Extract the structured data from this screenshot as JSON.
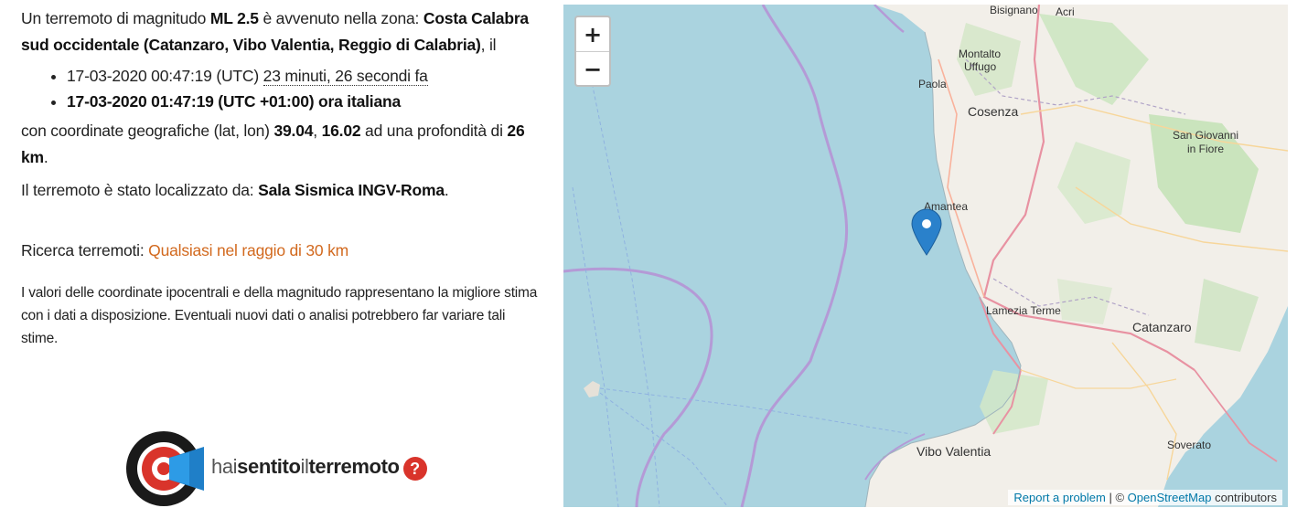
{
  "text": {
    "p1_a": "Un terremoto di magnitudo ",
    "p1_mag": "ML 2.5",
    "p1_b": " è avvenuto nella zona: ",
    "p1_zone": "Costa Calabra sud occidentale (Catanzaro, Vibo Valentia, Reggio di Calabria)",
    "p1_c": ", il",
    "utc_time": "17-03-2020 00:47:19 (UTC) ",
    "ago": "23 minuti, 26 secondi fa",
    "local_time": "17-03-2020 01:47:19 (UTC +01:00) ora italiana",
    "p2_a": "con coordinate geografiche (lat, lon) ",
    "lat": "39.04",
    "comma": ", ",
    "lon": "16.02",
    "p2_b": " ad una profondità di ",
    "depth": "26 km",
    "p2_c": ".",
    "p3_a": "Il terremoto è stato localizzato da: ",
    "locator": "Sala Sismica INGV-Roma",
    "p3_b": ".",
    "search_label": "Ricerca terremoti: ",
    "search_link": "Qualsiasi nel raggio di 30 km",
    "note": "I valori delle coordinate ipocentrali e della magnitudo rappresentano la migliore stima con i dati a disposizione. Eventuali nuovi dati o analisi potrebbero far variare tali stime."
  },
  "logo": {
    "thin1": "hai",
    "bold1": "sentito",
    "thin2": "il",
    "bold2": "terremoto",
    "q": "?"
  },
  "map": {
    "zoom_in": "+",
    "zoom_out": "−",
    "towns": {
      "bisignano": "Bisignano",
      "acri": "Acri",
      "montalto1": "Montalto",
      "montalto2": "Uffugo",
      "paola": "Paola",
      "cosenza": "Cosenza",
      "sangiovanni1": "San Giovanni",
      "sangiovanni2": "in Fiore",
      "amantea": "Amantea",
      "lamezia": "Lamezia Terme",
      "catanzaro": "Catanzaro",
      "vibo": "Vibo Valentia",
      "soverato": "Soverato"
    },
    "attribution": {
      "report": "Report a problem",
      "sep": " | © ",
      "osm": "OpenStreetMap",
      "contrib": " contributors"
    }
  },
  "colors": {
    "link": "#d2691e",
    "sea": "#aad3df",
    "land": "#f2efe9",
    "marker": "#2a81cb"
  }
}
